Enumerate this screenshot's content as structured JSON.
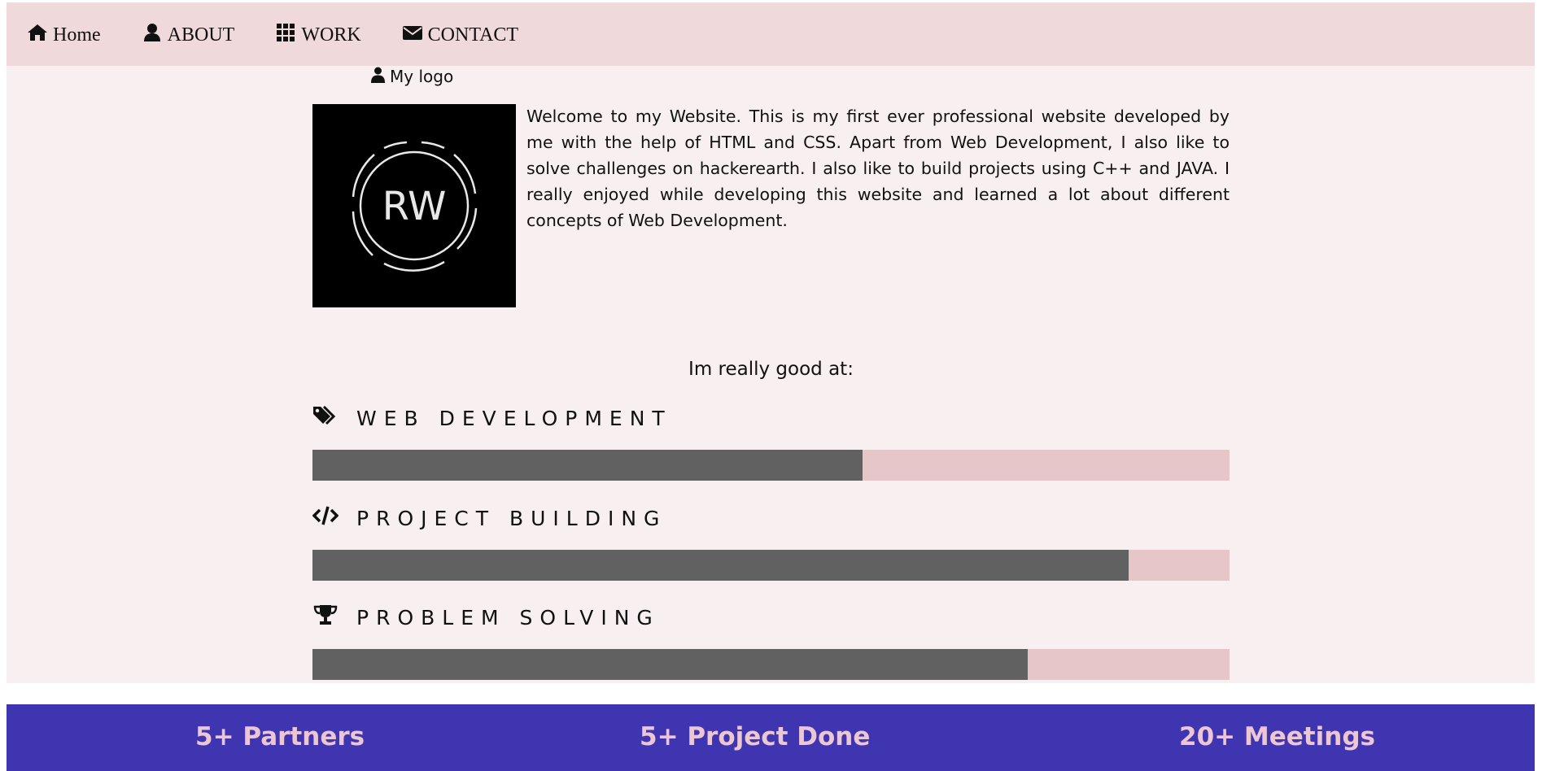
{
  "nav": {
    "items": [
      {
        "label": "Home",
        "icon": "home-icon"
      },
      {
        "label": "ABOUT",
        "icon": "user-icon"
      },
      {
        "label": "WORK",
        "icon": "grid-icon"
      },
      {
        "label": "CONTACT",
        "icon": "envelope-icon"
      }
    ]
  },
  "logo": {
    "caption": "My logo",
    "monogram": "RW"
  },
  "intro": {
    "text": "Welcome to my Website. This is my first ever professional website developed by me with the help of HTML and CSS. Apart from Web Development, I also like to solve challenges on hackerearth. I also like to build projects using C++ and JAVA. I really enjoyed while developing this website and learned a lot about different concepts of Web Development."
  },
  "skills": {
    "heading": "Im really good at:",
    "items": [
      {
        "label": "WEB DEVELOPMENT",
        "icon": "tags-icon",
        "level_percent": 60
      },
      {
        "label": "PROJECT BUILDING",
        "icon": "code-icon",
        "level_percent": 89
      },
      {
        "label": "PROBLEM SOLVING",
        "icon": "trophy-icon",
        "level_percent": 78
      }
    ]
  },
  "stats": {
    "items": [
      {
        "label": "5+ Partners"
      },
      {
        "label": "5+ Project Done"
      },
      {
        "label": "20+ Meetings"
      }
    ]
  },
  "colors": {
    "navbar_bg": "#efd9da",
    "page_bg": "#f7eff0",
    "bar_track": "#e6c6c8",
    "bar_fill": "#616161",
    "stats_bg": "#3f35b0",
    "stats_text": "#ecc7d3"
  }
}
